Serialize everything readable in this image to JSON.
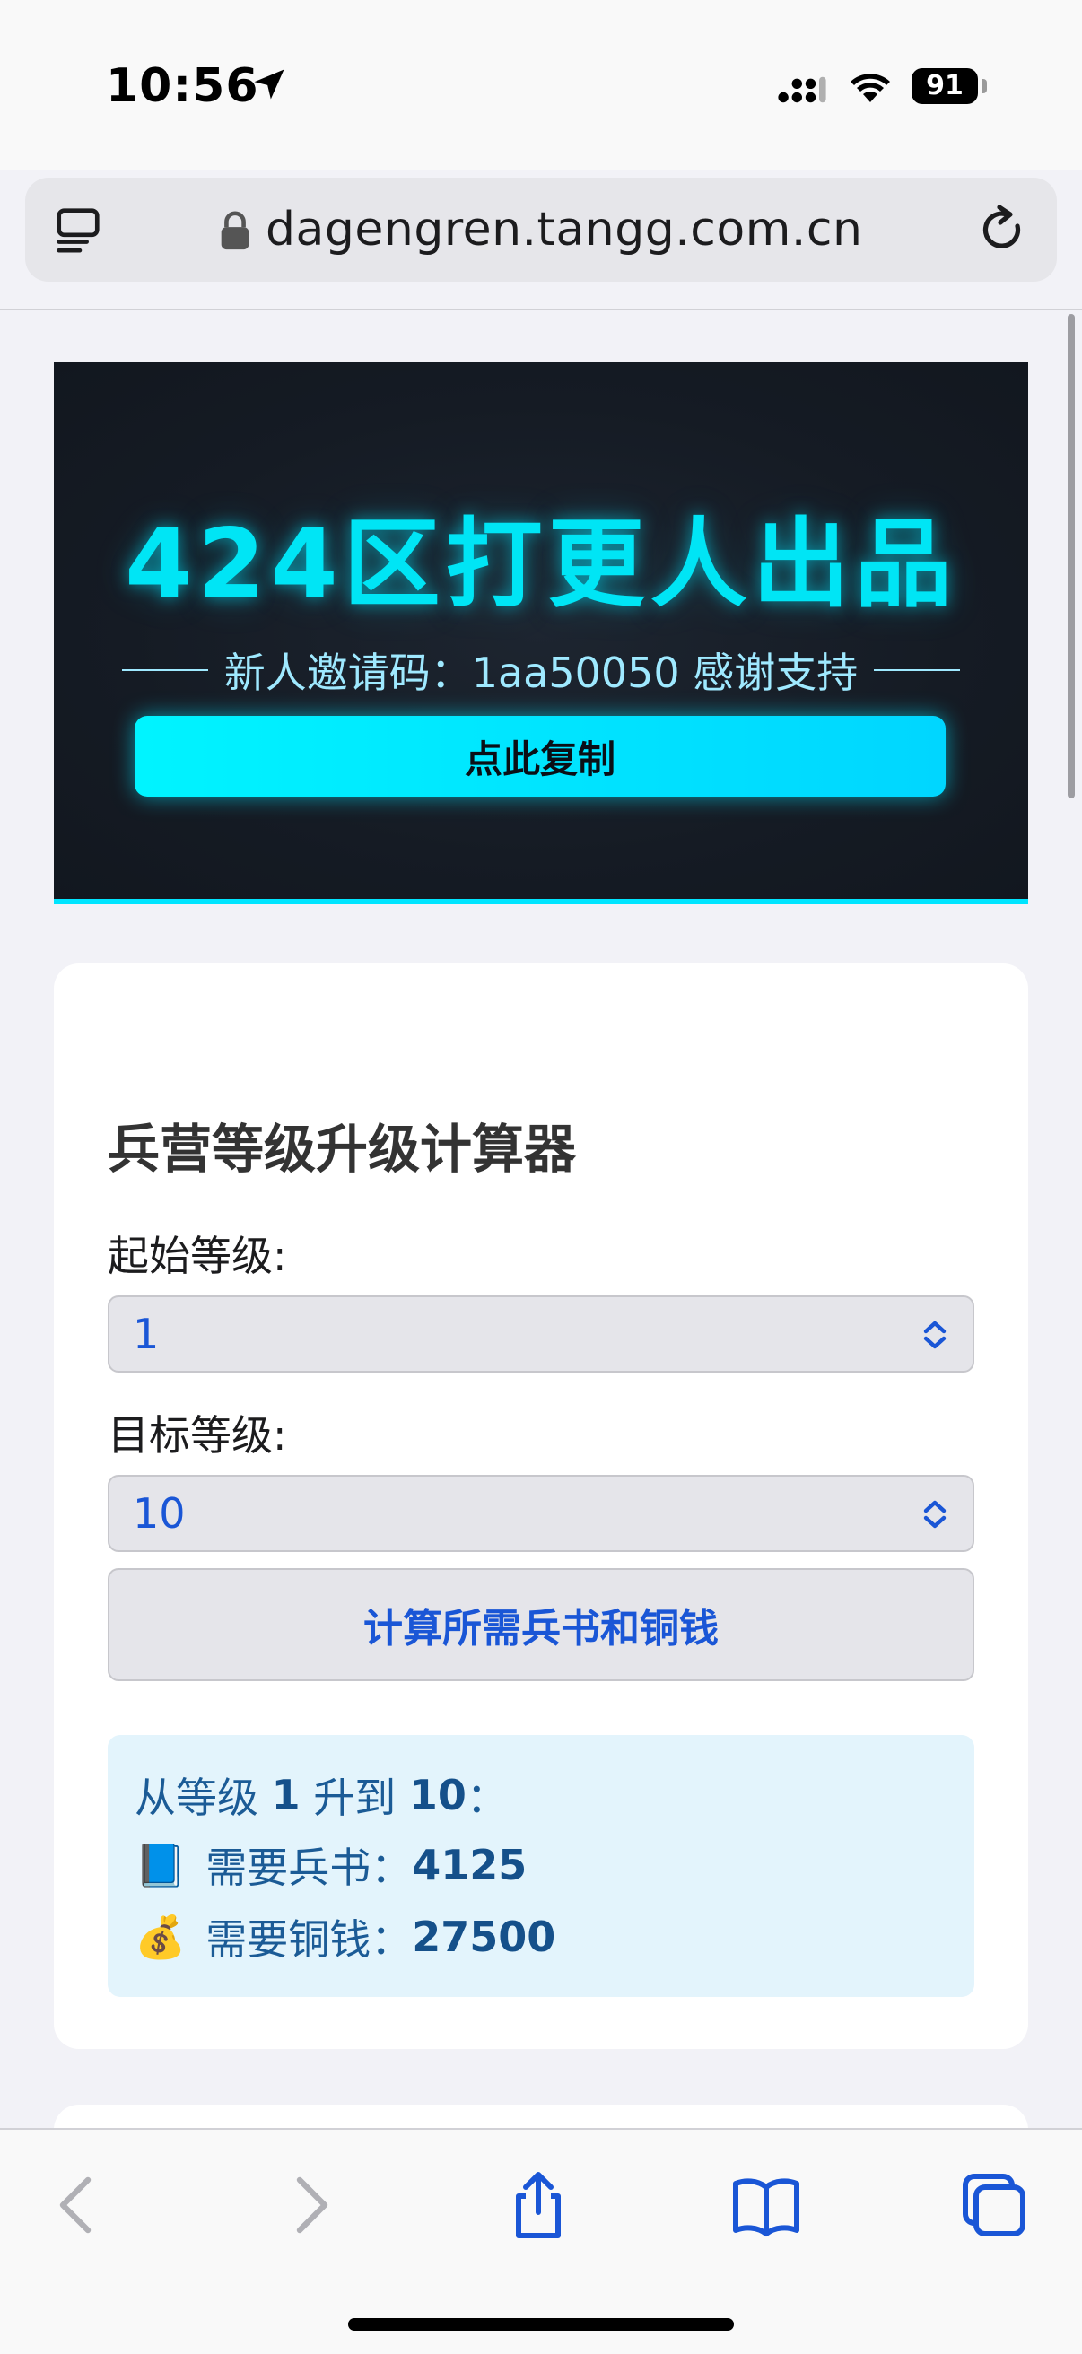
{
  "status_bar": {
    "time": "10:56",
    "battery": "91",
    "icons": [
      "location-arrow-icon",
      "signal-icon",
      "wifi-icon",
      "battery-icon"
    ]
  },
  "browser": {
    "url": "dagengren.tangg.com.cn",
    "icons": [
      "tabs-icon",
      "lock-icon",
      "reload-icon"
    ]
  },
  "banner": {
    "title": "424区打更人出品",
    "subtitle": "新人邀请码：1aa50050 感谢支持",
    "copy_button": "点此复制",
    "colors": {
      "accent": "#00e5ff",
      "background": "#151b24"
    }
  },
  "calculator": {
    "title": "兵营等级升级计算器",
    "start_label": "起始等级:",
    "start_value": "1",
    "target_label": "目标等级:",
    "target_value": "10",
    "calculate_button": "计算所需兵书和铜钱",
    "result": {
      "prefix": "从等级",
      "from": "1",
      "mid": "升到",
      "to": "10",
      "suffix": "：",
      "books_label": "需要兵书：",
      "books_value": "4125",
      "coins_label": "需要铜钱：",
      "coins_value": "27500",
      "books_emoji": "📘",
      "coins_emoji": "💰"
    },
    "colors": {
      "link_blue": "#1a56d6",
      "result_bg": "#e3f4fc"
    }
  },
  "toolbar": {
    "icons": [
      "back-icon",
      "forward-icon",
      "share-icon",
      "bookmarks-icon",
      "tabs-overview-icon"
    ]
  }
}
